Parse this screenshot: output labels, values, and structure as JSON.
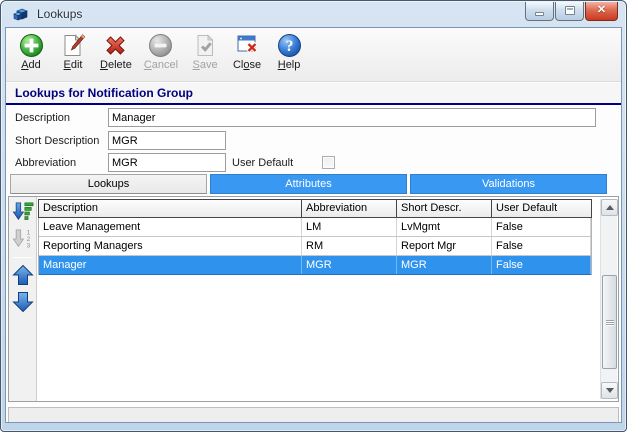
{
  "window": {
    "title": "Lookups"
  },
  "toolbar": {
    "buttons": [
      {
        "name": "Add",
        "pre": "",
        "key": "A",
        "post": "dd",
        "enabled": true
      },
      {
        "name": "Edit",
        "pre": "",
        "key": "E",
        "post": "dit",
        "enabled": true
      },
      {
        "name": "Delete",
        "pre": "",
        "key": "D",
        "post": "elete",
        "enabled": true
      },
      {
        "name": "Cancel",
        "pre": "",
        "key": "C",
        "post": "ancel",
        "enabled": false
      },
      {
        "name": "Save",
        "pre": "",
        "key": "S",
        "post": "ave",
        "enabled": false
      },
      {
        "name": "Close",
        "pre": "Cl",
        "key": "o",
        "post": "se",
        "enabled": true
      },
      {
        "name": "Help",
        "pre": "",
        "key": "H",
        "post": "elp",
        "enabled": true
      }
    ]
  },
  "section": {
    "title": "Lookups for Notification Group"
  },
  "form": {
    "description": {
      "label": "Description",
      "value": "Manager"
    },
    "short_description": {
      "label": "Short Description",
      "value": "MGR"
    },
    "abbreviation": {
      "label": "Abbreviation",
      "value": "MGR"
    },
    "user_default": {
      "label": "User Default",
      "checked": false
    }
  },
  "tabs": [
    {
      "label": "Lookups",
      "active": true
    },
    {
      "label": "Attributes",
      "active": false
    },
    {
      "label": "Validations",
      "active": false
    }
  ],
  "grid": {
    "columns": [
      "Description",
      "Abbreviation",
      "Short Descr.",
      "User Default"
    ],
    "rows": [
      {
        "description": "Leave Management",
        "abbreviation": "LM",
        "short_descr": "LvMgmt",
        "user_default": "False",
        "selected": false
      },
      {
        "description": "Reporting Managers",
        "abbreviation": "RM",
        "short_descr": "Report Mgr",
        "user_default": "False",
        "selected": false
      },
      {
        "description": "Manager",
        "abbreviation": "MGR",
        "short_descr": "MGR",
        "user_default": "False",
        "selected": true
      }
    ]
  },
  "colors": {
    "tab_inactive_blue": "#3898f2",
    "selected_row_blue": "#2f93ee",
    "section_navy": "#000080",
    "close_button_red": "#c93a20"
  }
}
